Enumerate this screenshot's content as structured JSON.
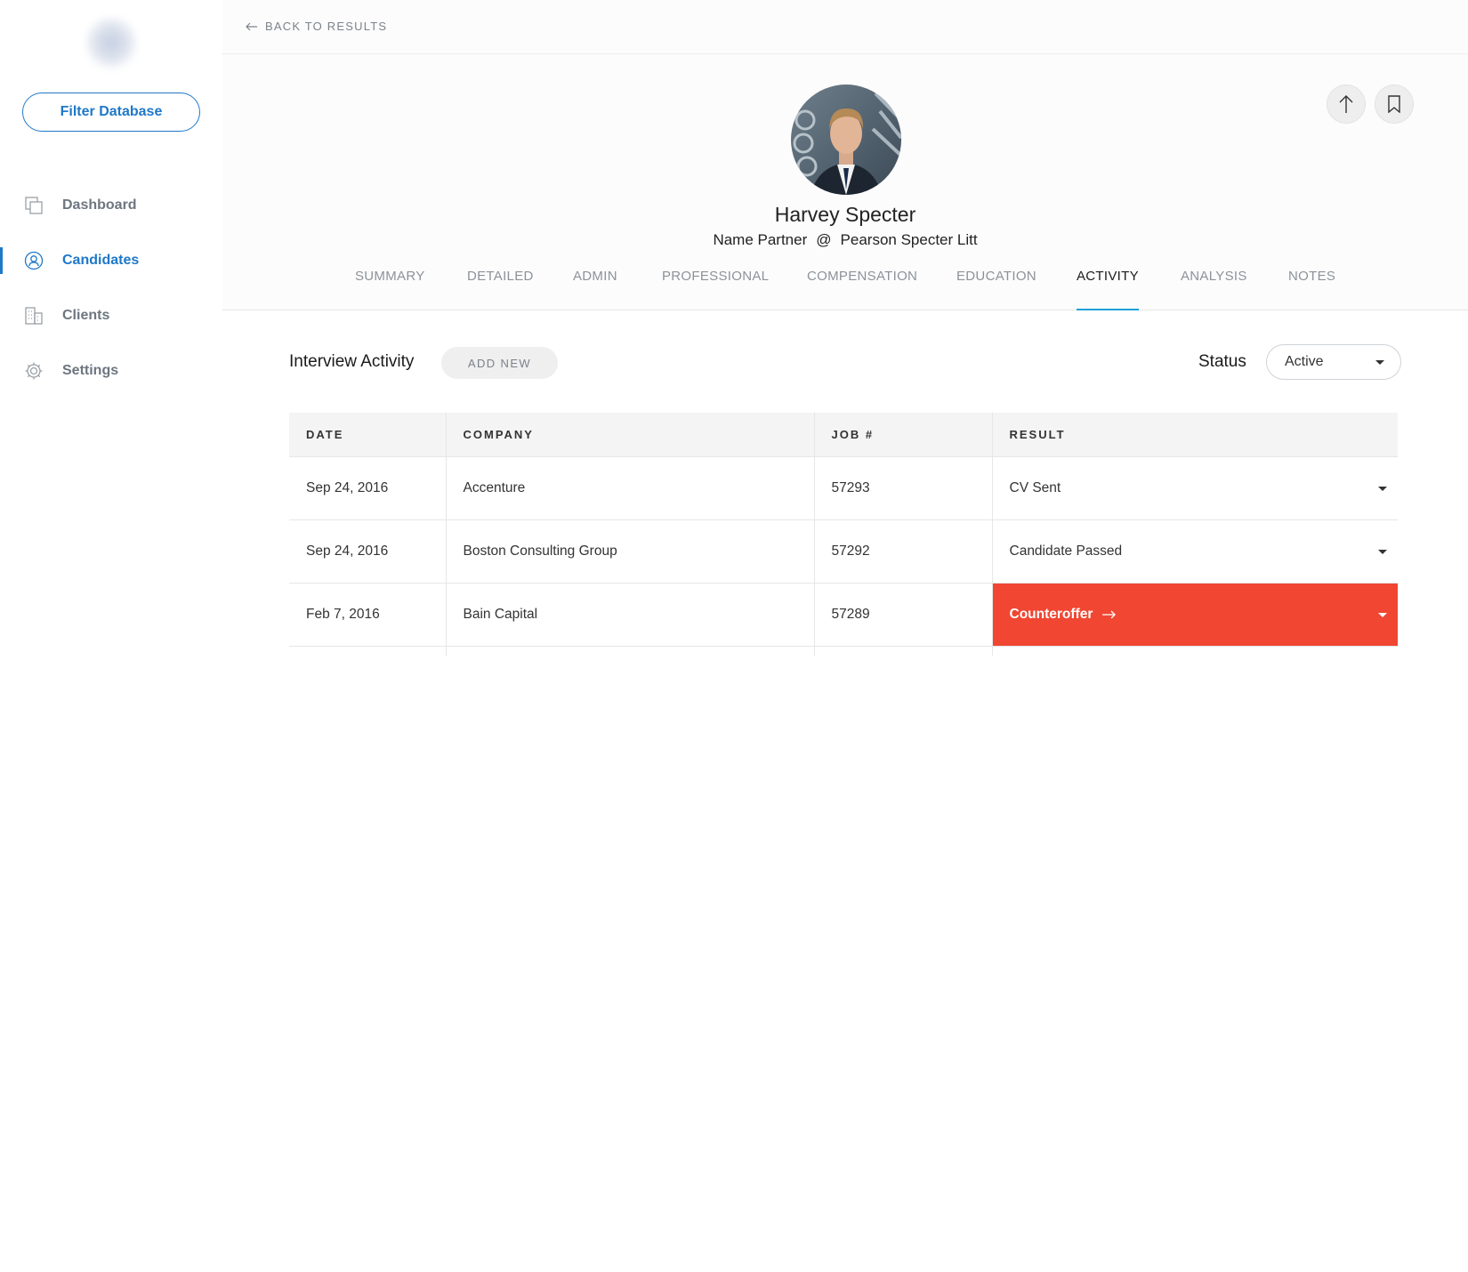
{
  "sidebar": {
    "filter_button": "Filter Database",
    "items": [
      {
        "label": "Dashboard",
        "icon": "copy-icon",
        "active": false
      },
      {
        "label": "Candidates",
        "icon": "user-circle-icon",
        "active": true
      },
      {
        "label": "Clients",
        "icon": "building-icon",
        "active": false
      },
      {
        "label": "Settings",
        "icon": "gear-icon",
        "active": false
      }
    ]
  },
  "topbar": {
    "back_label": "BACK TO RESULTS"
  },
  "profile": {
    "name": "Harvey Specter",
    "title": "Name Partner",
    "at": "@",
    "company": "Pearson Specter Litt"
  },
  "tabs": [
    {
      "label": "SUMMARY",
      "active": false
    },
    {
      "label": "DETAILED",
      "active": false
    },
    {
      "label": "ADMIN",
      "active": false
    },
    {
      "label": "PROFESSIONAL",
      "active": false
    },
    {
      "label": "COMPENSATION",
      "active": false
    },
    {
      "label": "EDUCATION",
      "active": false
    },
    {
      "label": "ACTIVITY",
      "active": true
    },
    {
      "label": "ANALYSIS",
      "active": false
    },
    {
      "label": "NOTES",
      "active": false
    }
  ],
  "activity": {
    "title": "Interview Activity",
    "add_new": "ADD NEW",
    "status_label": "Status",
    "status_value": "Active",
    "columns": [
      "DATE",
      "COMPANY",
      "JOB #",
      "RESULT"
    ],
    "rows": [
      {
        "date": "Sep 24, 2016",
        "company": "Accenture",
        "job": "57293",
        "result": "CV Sent",
        "highlight": false
      },
      {
        "date": "Sep 24, 2016",
        "company": "Boston Consulting Group",
        "job": "57292",
        "result": "Candidate Passed",
        "highlight": false
      },
      {
        "date": "Feb 7, 2016",
        "company": "Bain Capital",
        "job": "57289",
        "result": "Counteroffer",
        "highlight": true
      }
    ]
  },
  "colors": {
    "accent": "#1f78c8",
    "tab_underline": "#1ea0d8",
    "alert": "#f04632"
  }
}
